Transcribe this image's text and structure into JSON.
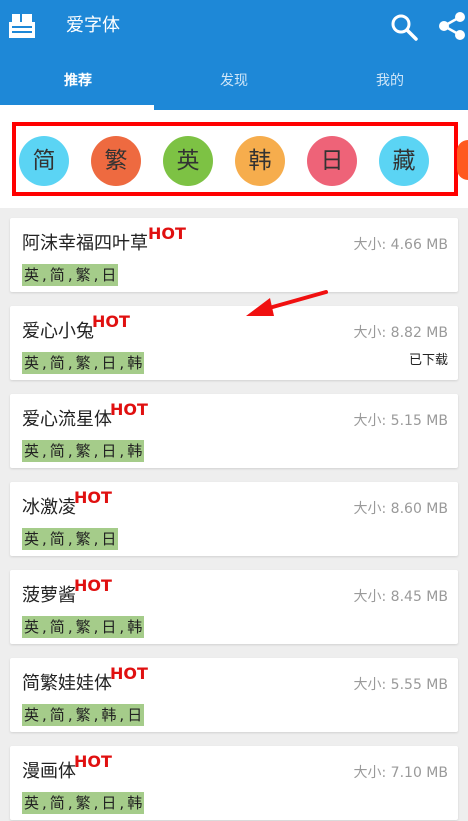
{
  "app": {
    "title": "爱字体"
  },
  "tabs": [
    {
      "label": "推荐",
      "active": true
    },
    {
      "label": "发现",
      "active": false
    },
    {
      "label": "我的",
      "active": false
    }
  ],
  "languages": [
    {
      "label": "简",
      "color": "#5bd4f4"
    },
    {
      "label": "繁",
      "color": "#ee6a40"
    },
    {
      "label": "英",
      "color": "#7dc244"
    },
    {
      "label": "韩",
      "color": "#f6ad4d"
    },
    {
      "label": "日",
      "color": "#ee6378"
    },
    {
      "label": "藏",
      "color": "#5bd4f4"
    }
  ],
  "hot_label": "HOT",
  "fonts": [
    {
      "name": "阿沫幸福四叶草",
      "hot": true,
      "size": "大小: 4.66 MB",
      "tags": [
        "英",
        "简",
        "繁",
        "日"
      ],
      "status": ""
    },
    {
      "name": "爱心小兔",
      "hot": true,
      "size": "大小: 8.82 MB",
      "tags": [
        "英",
        "简",
        "繁",
        "日",
        "韩"
      ],
      "status": "已下载"
    },
    {
      "name": "爱心流星体",
      "hot": true,
      "size": "大小: 5.15 MB",
      "tags": [
        "英",
        "简",
        "繁",
        "日",
        "韩"
      ],
      "status": ""
    },
    {
      "name": "冰激凌",
      "hot": true,
      "size": "大小: 8.60 MB",
      "tags": [
        "英",
        "简",
        "繁",
        "日"
      ],
      "status": ""
    },
    {
      "name": "菠萝酱",
      "hot": true,
      "size": "大小: 8.45 MB",
      "tags": [
        "英",
        "简",
        "繁",
        "日",
        "韩"
      ],
      "status": ""
    },
    {
      "name": "简繁娃娃体",
      "hot": true,
      "size": "大小: 5.55 MB",
      "tags": [
        "英",
        "简",
        "繁",
        "韩",
        "日"
      ],
      "status": ""
    },
    {
      "name": "漫画体",
      "hot": true,
      "size": "大小: 7.10 MB",
      "tags": [
        "英",
        "简",
        "繁",
        "日",
        "韩"
      ],
      "status": ""
    }
  ],
  "colors": {
    "appbar": "#1e88d7",
    "highlight": "#ff0000",
    "hot": "#e01010",
    "tag": "#a5cc8a"
  }
}
